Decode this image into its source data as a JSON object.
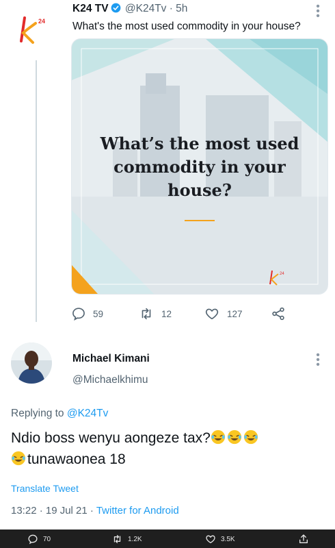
{
  "tweet": {
    "author_name": "K24 TV",
    "handle_time": "@K24Tv · 5h",
    "text": "What's the most used commodity in your house?",
    "media_title": "What’s the most used\ncommodity in your\nhouse?",
    "logo_mark": "k24",
    "actions": {
      "replies": "59",
      "retweets": "12",
      "likes": "127"
    }
  },
  "reply": {
    "author_name": "Michael Kimani",
    "handle": "@Michaelkhimu",
    "replying_to_label": "Replying to",
    "replying_to_handle": "@K24Tv",
    "text_line1": "Ndio boss wenyu aongeze tax?",
    "text_line2": "tunawaonea 18",
    "emoji": "rolling-on-floor-laughing",
    "translate_label": "Translate Tweet",
    "timestamp": "13:22 · 19 Jul 21 · ",
    "source": "Twitter for Android"
  },
  "bottom_bar": {
    "replies": "70",
    "retweets": "1.2K",
    "likes": "3.5K"
  },
  "colors": {
    "link": "#1d9bf0",
    "muted": "#536471",
    "brand_orange": "#f4a21d",
    "brand_red": "#e22b2b"
  }
}
